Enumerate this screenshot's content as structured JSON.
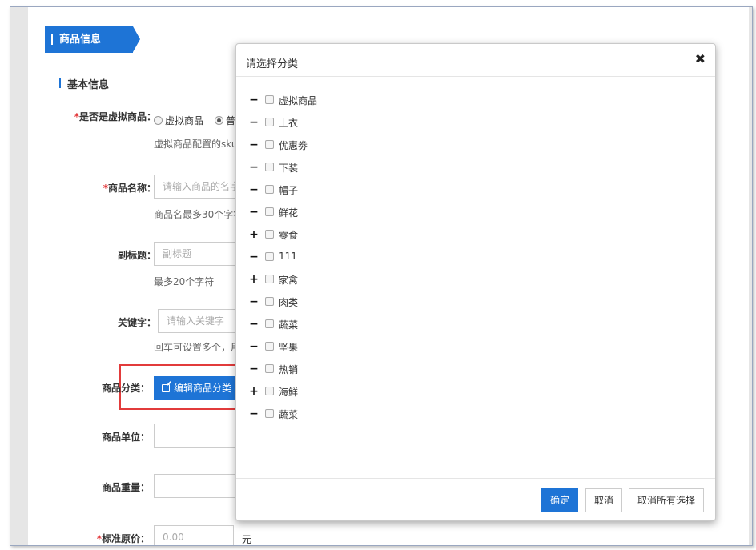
{
  "page": {
    "ribbon_title": "商品信息",
    "section_title": "基本信息"
  },
  "form": {
    "virtual": {
      "required_mark": "*",
      "label": "是否是虚拟商品：",
      "option_virtual": "虚拟商品",
      "option_normal": "普",
      "hint": "虚拟商品配置的sku"
    },
    "name": {
      "required_mark": "*",
      "label": "商品名称：",
      "placeholder": "请输入商品的名字",
      "hint": "商品名最多30个字符"
    },
    "subtitle": {
      "label": "副标题：",
      "placeholder": "副标题",
      "hint": "最多20个字符"
    },
    "keywords": {
      "label": "关键字：",
      "placeholder": "请输入关键字",
      "hint": "回车可设置多个，用"
    },
    "category": {
      "label": "商品分类：",
      "button": "编辑商品分类"
    },
    "unit": {
      "label": "商品单位："
    },
    "weight": {
      "label": "商品重量："
    },
    "price": {
      "required_mark": "*",
      "label": "标准原价：",
      "placeholder": "0.00",
      "unit": "元"
    }
  },
  "dialog": {
    "title": "请选择分类",
    "close_icon": "✖",
    "categories": [
      {
        "toggle": "−",
        "label": "虚拟商品"
      },
      {
        "toggle": "−",
        "label": "上衣"
      },
      {
        "toggle": "−",
        "label": "优惠劵"
      },
      {
        "toggle": "−",
        "label": "下装"
      },
      {
        "toggle": "−",
        "label": "帽子"
      },
      {
        "toggle": "−",
        "label": "鲜花"
      },
      {
        "toggle": "+",
        "label": "零食"
      },
      {
        "toggle": "−",
        "label": "111"
      },
      {
        "toggle": "+",
        "label": "家禽"
      },
      {
        "toggle": "−",
        "label": "肉类"
      },
      {
        "toggle": "−",
        "label": "蔬菜"
      },
      {
        "toggle": "−",
        "label": "坚果"
      },
      {
        "toggle": "−",
        "label": "热销"
      },
      {
        "toggle": "+",
        "label": "海鲜"
      },
      {
        "toggle": "−",
        "label": "蔬菜"
      }
    ],
    "buttons": {
      "confirm": "确定",
      "cancel": "取消",
      "clear_all": "取消所有选择"
    }
  },
  "colors": {
    "accent": "#1e74d6",
    "highlight_border": "#e23b3b",
    "required": "#e4393c"
  }
}
